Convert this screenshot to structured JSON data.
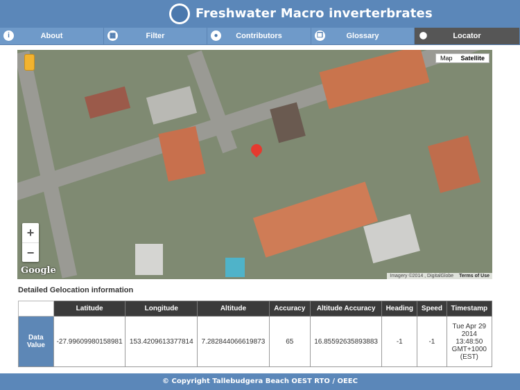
{
  "app": {
    "title": "Freshwater Macro inverterbrates"
  },
  "nav": {
    "tabs": [
      {
        "label": "About",
        "icon": "info-icon"
      },
      {
        "label": "Filter",
        "icon": "grid-icon"
      },
      {
        "label": "Contributors",
        "icon": "people-icon"
      },
      {
        "label": "Glossary",
        "icon": "book-icon"
      },
      {
        "label": "Locator",
        "icon": "location-pin-icon",
        "active": true
      }
    ]
  },
  "map": {
    "type_map": "Map",
    "type_satellite": "Satellite",
    "zoom_in": "+",
    "zoom_out": "−",
    "logo": "Google",
    "imagery": "Imagery ©2014 , DigitalGlobe",
    "terms": "Terms of Use"
  },
  "geo": {
    "title": "Detailed Gelocation information",
    "columns": [
      "Latitude",
      "Longitude",
      "Altitude",
      "Accuracy",
      "Altitude Accuracy",
      "Heading",
      "Speed",
      "Timestamp"
    ],
    "row_label": "Data Value",
    "values": [
      "-27.99609980158981",
      "153.4209613377814",
      "7.282844066619873",
      "65",
      "16.85592635893883",
      "-1",
      "-1",
      "Tue Apr 29 2014 13:48:50 GMT+1000 (EST)"
    ]
  },
  "footer": {
    "text": "© Copyright Tallebudgera Beach OEST RTO / OEEC"
  }
}
